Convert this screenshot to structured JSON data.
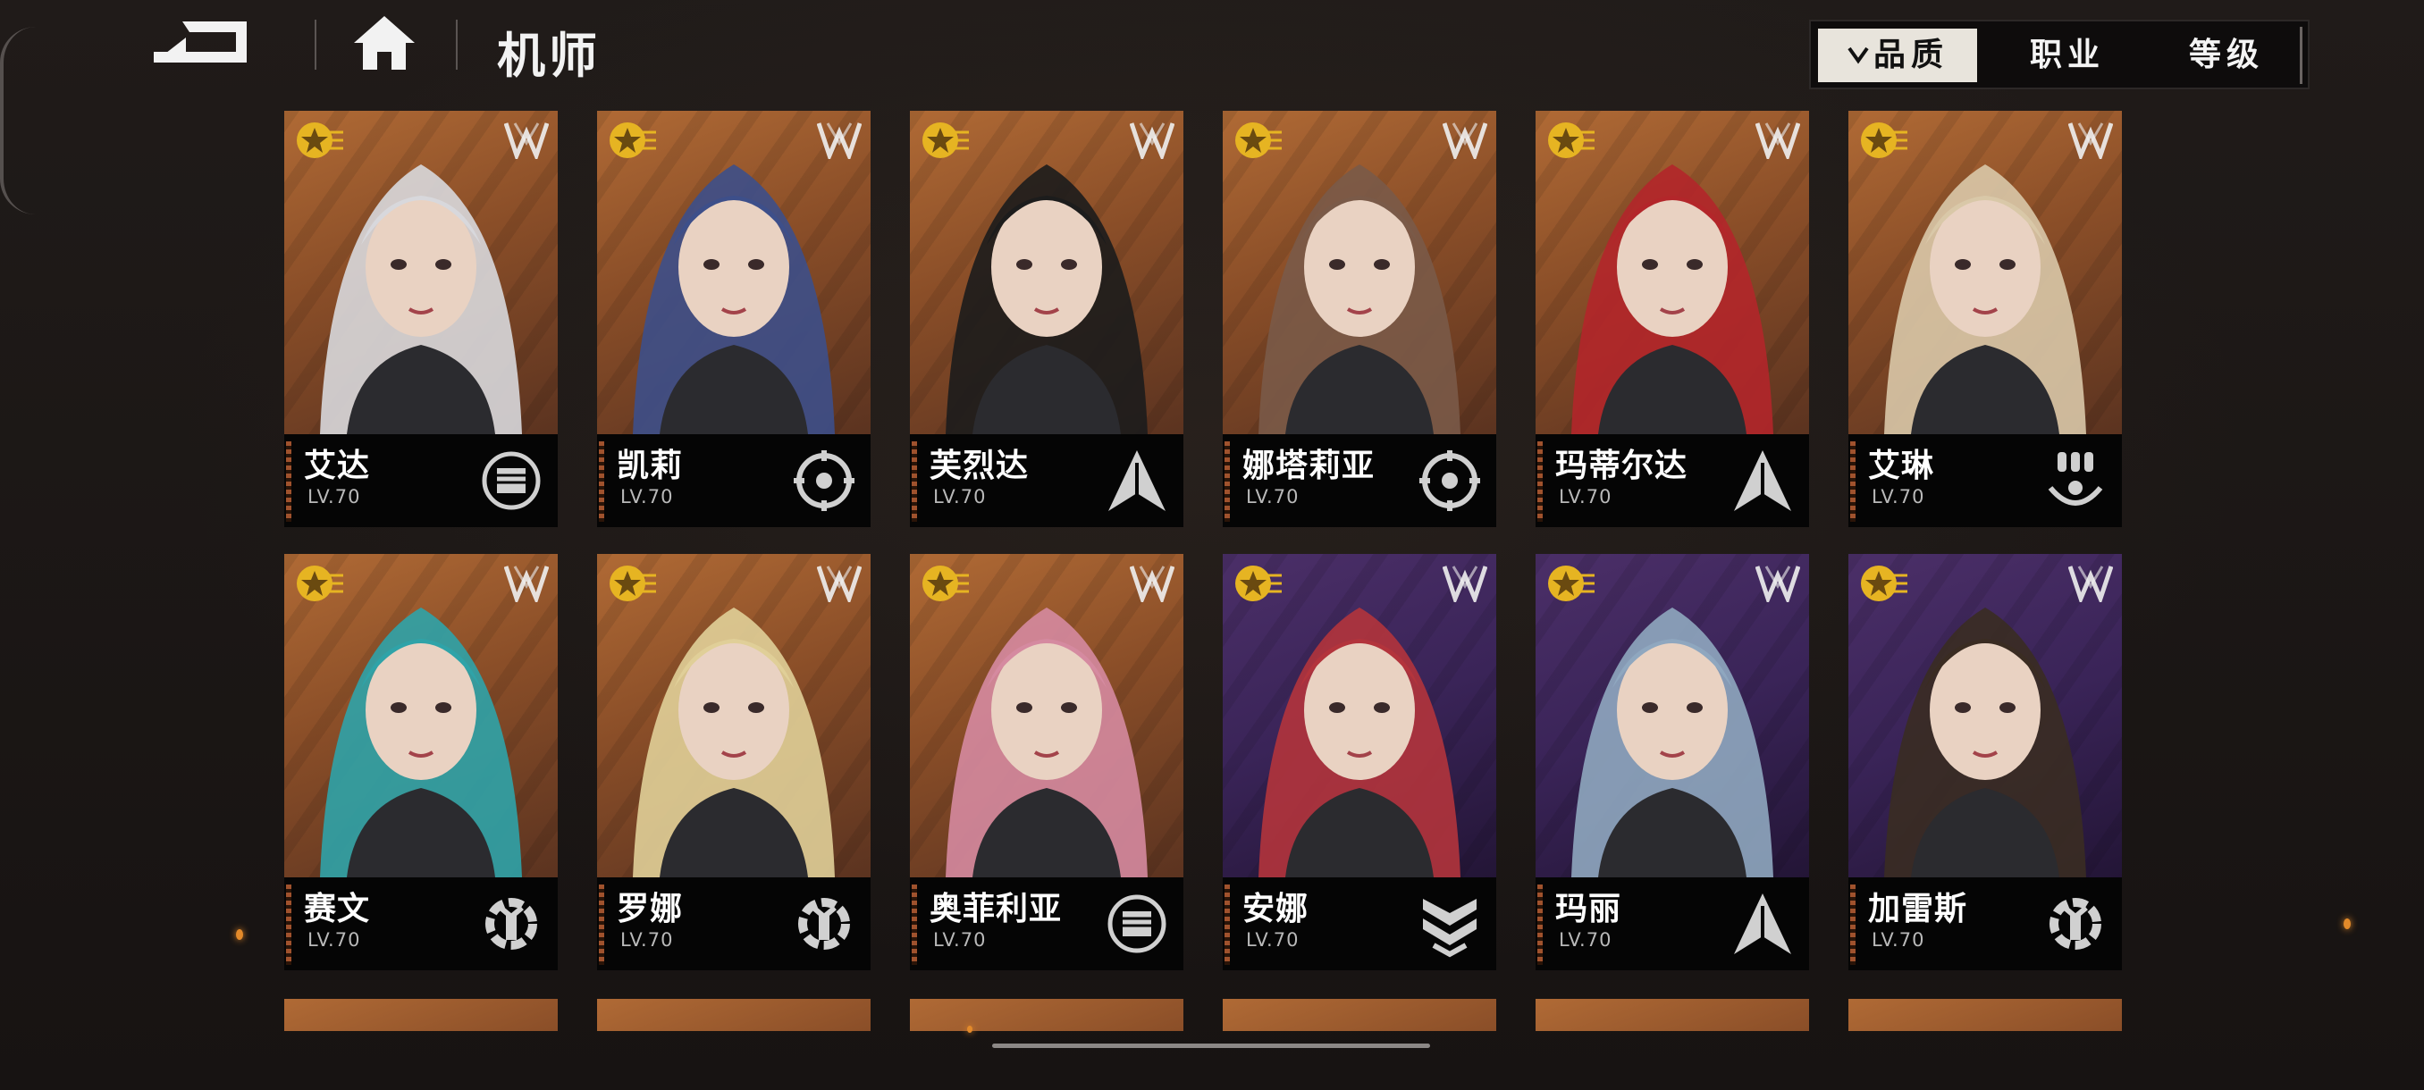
{
  "header": {
    "title": "机师"
  },
  "filters": [
    {
      "label": "品质",
      "active": true,
      "icon": "chevron-down-icon"
    },
    {
      "label": "职业",
      "active": false
    },
    {
      "label": "等级",
      "active": false
    }
  ],
  "cards": [
    {
      "name": "艾达",
      "level": "LV.70",
      "role_icon": "fist-icon",
      "bg": "orange"
    },
    {
      "name": "凯莉",
      "level": "LV.70",
      "role_icon": "target-icon",
      "bg": "orange"
    },
    {
      "name": "芙烈达",
      "level": "LV.70",
      "role_icon": "arrow-icon",
      "bg": "orange"
    },
    {
      "name": "娜塔莉亚",
      "level": "LV.70",
      "role_icon": "target-icon",
      "bg": "orange"
    },
    {
      "name": "玛蒂尔达",
      "level": "LV.70",
      "role_icon": "arrow-icon",
      "bg": "orange"
    },
    {
      "name": "艾琳",
      "level": "LV.70",
      "role_icon": "support-icon",
      "bg": "orange"
    },
    {
      "name": "赛文",
      "level": "LV.70",
      "role_icon": "wrench-icon",
      "bg": "orange"
    },
    {
      "name": "罗娜",
      "level": "LV.70",
      "role_icon": "wrench-icon",
      "bg": "orange"
    },
    {
      "name": "奥菲利亚",
      "level": "LV.70",
      "role_icon": "fist-icon",
      "bg": "orange"
    },
    {
      "name": "安娜",
      "level": "LV.70",
      "role_icon": "shield-icon",
      "bg": "purple"
    },
    {
      "name": "玛丽",
      "level": "LV.70",
      "role_icon": "arrow-icon",
      "bg": "purple"
    },
    {
      "name": "加雷斯",
      "level": "LV.70",
      "role_icon": "wrench-icon",
      "bg": "purple"
    }
  ],
  "colors": {
    "accent_orange": "#b06a35",
    "accent_purple": "#4b2f68",
    "star_gold": "#e6b422",
    "background": "#1c1817"
  }
}
